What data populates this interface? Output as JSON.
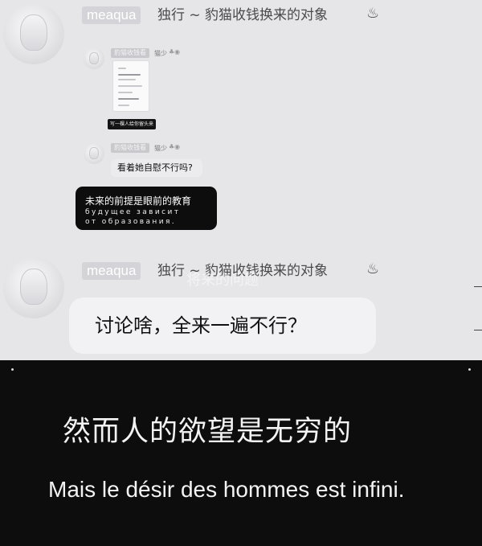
{
  "post1": {
    "username": "meaqua",
    "group_title": "独行 ~ 豹猫收钱换来的对象",
    "title_icon": "bonfire-icon"
  },
  "reply1": {
    "username": "豹猫收钱看",
    "level_tag": "猫少",
    "thumbnail_caption": "写一棵人给你留头来"
  },
  "reply2": {
    "username": "豹猫收钱看",
    "level_tag": "猫少",
    "message": "看着她自慰不行吗?"
  },
  "quote_card": {
    "line1": "未来的前提是眼前的教育",
    "line2": "будущее зависит",
    "line3": "от образования."
  },
  "post2": {
    "username": "meaqua",
    "group_title": "独行 ~ 豹猫收钱换来的对象",
    "overlay_text": "将来的问题",
    "message": "讨论啥，全来一遍不行？"
  },
  "subtitle": {
    "chinese": "然而人的欲望是无穷的",
    "french": "Mais le désir des hommes est infini."
  },
  "colors": {
    "page_bg": "#e6e6e8",
    "panel_bg": "#0d0d0d",
    "subtitle_text": "#f3f3f3"
  }
}
